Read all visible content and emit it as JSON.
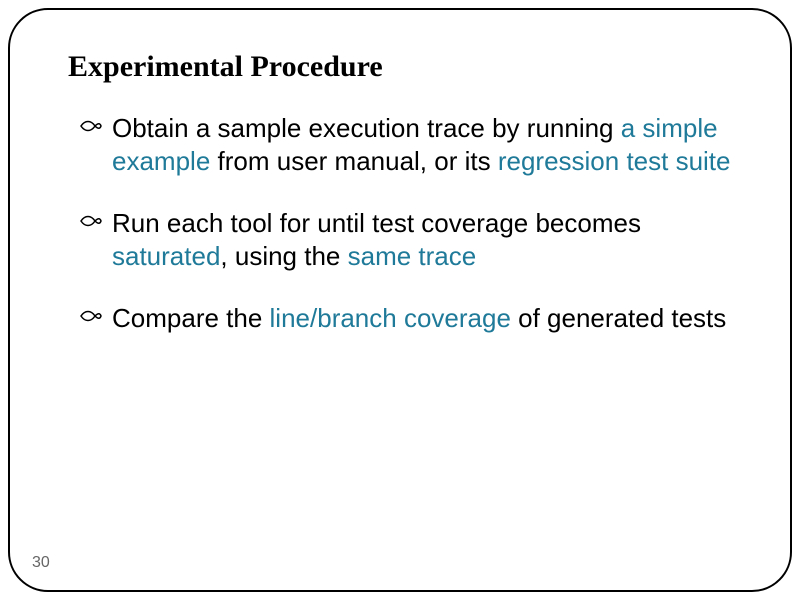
{
  "title": "Experimental Procedure",
  "bullets": [
    {
      "segments": [
        {
          "text": "Obtain a sample execution trace by running ",
          "hl": false
        },
        {
          "text": "a simple example",
          "hl": true
        },
        {
          "text": " from user manual, or its ",
          "hl": false
        },
        {
          "text": "regression test suite",
          "hl": true
        }
      ]
    },
    {
      "segments": [
        {
          "text": "Run each tool for until test coverage becomes ",
          "hl": false
        },
        {
          "text": "saturated",
          "hl": true
        },
        {
          "text": ", using the ",
          "hl": false
        },
        {
          "text": "same trace",
          "hl": true
        }
      ]
    },
    {
      "segments": [
        {
          "text": "Compare the ",
          "hl": false
        },
        {
          "text": "line/branch coverage",
          "hl": true
        },
        {
          "text": " of generated tests",
          "hl": false
        }
      ]
    }
  ],
  "pageNumber": "30"
}
